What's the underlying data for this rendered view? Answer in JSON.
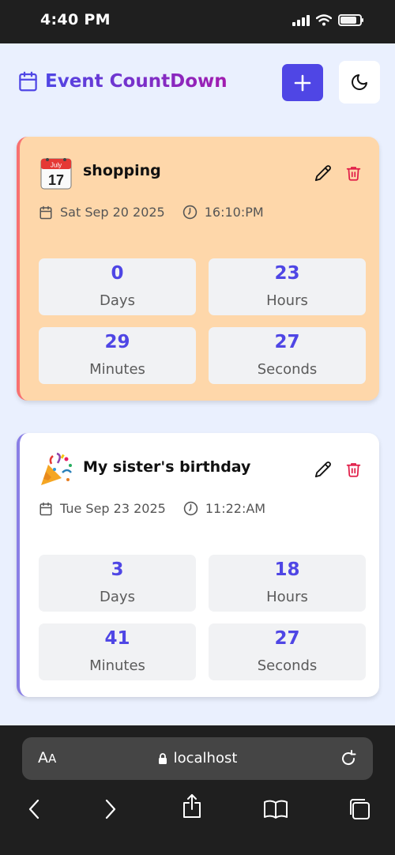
{
  "status_bar": {
    "time": "4:40 PM",
    "battery_level": 0.85
  },
  "header": {
    "title": "Event CountDown",
    "icons": {
      "brand": "calendar-icon",
      "add": "plus-icon",
      "theme": "moon-icon"
    },
    "colors": {
      "accent": "#4f46e5",
      "gradient_end": "#a21caf"
    }
  },
  "events": [
    {
      "emoji": "calendar-emoji",
      "emoji_text": "July",
      "emoji_number": "17",
      "title": "shopping",
      "date": "Sat Sep 20 2025",
      "time": "16:10:PM",
      "card_color": "#fed7aa",
      "border_color": "#f87171",
      "countdown": [
        {
          "value": "0",
          "label": "Days"
        },
        {
          "value": "23",
          "label": "Hours"
        },
        {
          "value": "29",
          "label": "Minutes"
        },
        {
          "value": "27",
          "label": "Seconds"
        }
      ]
    },
    {
      "emoji": "party-popper-emoji",
      "title": "My sister's birthday",
      "date": "Tue Sep 23 2025",
      "time": "11:22:AM",
      "card_color": "#ffffff",
      "border_color": "#8a7fe6",
      "countdown": [
        {
          "value": "3",
          "label": "Days"
        },
        {
          "value": "18",
          "label": "Hours"
        },
        {
          "value": "41",
          "label": "Minutes"
        },
        {
          "value": "27",
          "label": "Seconds"
        }
      ]
    }
  ],
  "browser": {
    "text_size_label": "AA",
    "url": "localhost",
    "icons": [
      "lock-icon",
      "reload-icon",
      "back-icon",
      "forward-icon",
      "share-icon",
      "bookmarks-icon",
      "tabs-icon"
    ]
  }
}
